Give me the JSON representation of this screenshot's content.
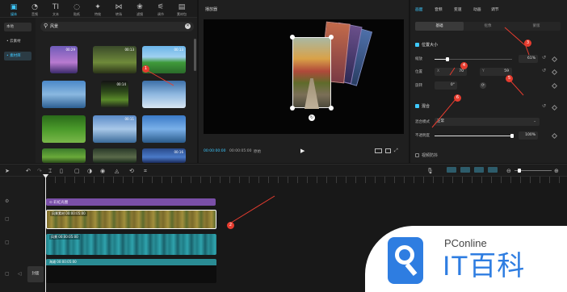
{
  "toolbar": {
    "items": [
      {
        "label": "媒体",
        "icon": "media-icon",
        "glyph": "▣"
      },
      {
        "label": "音频",
        "icon": "audio-icon",
        "glyph": "◔"
      },
      {
        "label": "文本",
        "icon": "text-icon",
        "glyph": "TI"
      },
      {
        "label": "贴纸",
        "icon": "sticker-icon",
        "glyph": "◌"
      },
      {
        "label": "特效",
        "icon": "effect-icon",
        "glyph": "✦"
      },
      {
        "label": "转场",
        "icon": "transition-icon",
        "glyph": "⋈"
      },
      {
        "label": "滤镜",
        "icon": "filter-icon",
        "glyph": "❀"
      },
      {
        "label": "调节",
        "icon": "adjust-icon",
        "glyph": "⚟"
      },
      {
        "label": "素材包",
        "icon": "material-pack-icon",
        "glyph": "▤"
      }
    ]
  },
  "media_sidebar": {
    "items": [
      "本地",
      "• 云素材",
      "• 素材库"
    ]
  },
  "search": {
    "value": "风景"
  },
  "thumbs": [
    {
      "dur": "00:29"
    },
    {
      "dur": "00:13"
    },
    {
      "dur": "00:13"
    },
    {
      "dur": ""
    },
    {
      "dur": "00:14"
    },
    {
      "dur": ""
    },
    {
      "dur": ""
    },
    {
      "dur": "00:11"
    },
    {
      "dur": ""
    },
    {
      "dur": ""
    },
    {
      "dur": ""
    },
    {
      "dur": "00:16"
    }
  ],
  "player": {
    "title": "播放器",
    "time_current": "00:00:00:00",
    "time_total": "00:00:05:00",
    "label": "原始"
  },
  "inspector": {
    "tabs": [
      "画面",
      "音频",
      "变速",
      "动画",
      "调节"
    ],
    "subtabs": [
      "基础",
      "抠像",
      "蒙版"
    ],
    "pos_size_label": "位置大小",
    "scale_label": "缩放",
    "scale_value": "61%",
    "position_label": "位置",
    "x_label": "X",
    "x_value": "70",
    "y_label": "Y",
    "y_value": "59",
    "rotate_label": "旋转",
    "rotate_value": "0°",
    "blend_label": "混合",
    "blend_mode_label": "混合模式",
    "blend_mode_value": "正常",
    "opacity_label": "不透明度",
    "opacity_value": "100%",
    "stabilize_label": "视频防抖"
  },
  "annotations": [
    "1",
    "2",
    "3",
    "4",
    "5",
    "6"
  ],
  "timeline": {
    "effect_clip_label": "⊙ 彩虹光圈",
    "clip1_label": "风景素材  00:00:05:00",
    "clip2_label": "风景  00:00:05:00",
    "clip3_label": "海滩  00:00:05:00",
    "cover_label": "封面"
  },
  "watermark": {
    "brand": "PConline",
    "title": "IT百科"
  }
}
